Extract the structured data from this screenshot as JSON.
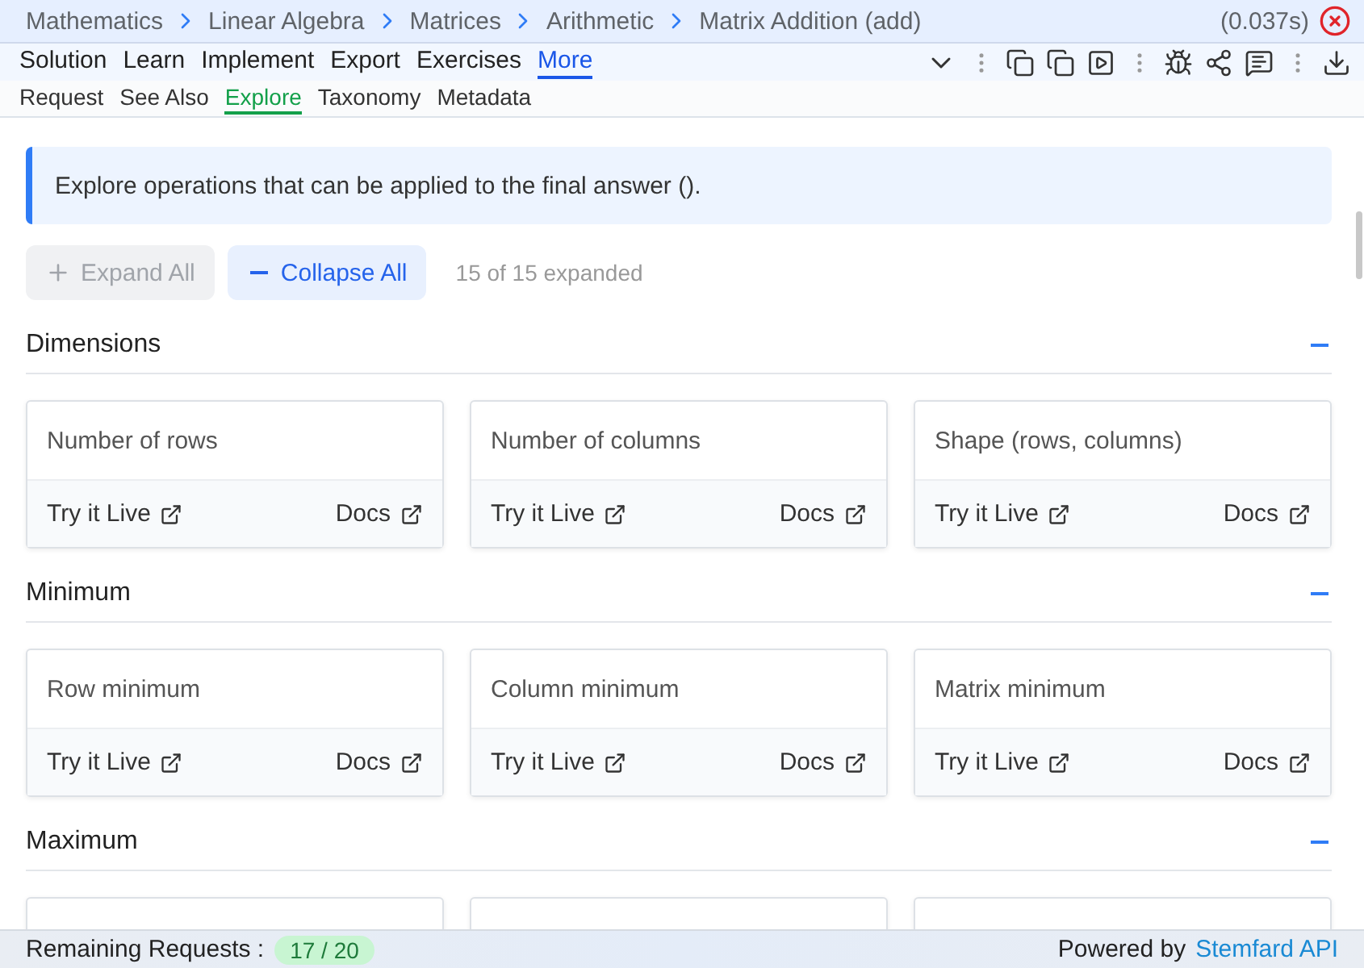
{
  "breadcrumbs": [
    "Mathematics",
    "Linear Algebra",
    "Matrices",
    "Arithmetic",
    "Matrix Addition (add)"
  ],
  "timing": "(0.037s)",
  "tabs": [
    {
      "label": "Solution",
      "selected": false
    },
    {
      "label": "Learn",
      "selected": false
    },
    {
      "label": "Implement",
      "selected": false
    },
    {
      "label": "Export",
      "selected": false
    },
    {
      "label": "Exercises",
      "selected": false
    },
    {
      "label": "More",
      "selected": true
    }
  ],
  "subtabs": [
    {
      "label": "Request",
      "selected": false
    },
    {
      "label": "See Also",
      "selected": false
    },
    {
      "label": "Explore",
      "selected": true
    },
    {
      "label": "Taxonomy",
      "selected": false
    },
    {
      "label": "Metadata",
      "selected": false
    }
  ],
  "info": "Explore operations that can be applied to the final answer ().",
  "expand_button": {
    "label": "Expand All",
    "disabled": true
  },
  "collapse_button": {
    "label": "Collapse All",
    "disabled": false
  },
  "expanded_count": "15 of 15 expanded",
  "sections": [
    {
      "title": "Dimensions",
      "expanded": true,
      "cards": [
        {
          "kind": "full",
          "title": "Number of rows",
          "try": "Try it Live",
          "docs": "Docs"
        },
        {
          "kind": "full",
          "title": "Number of columns",
          "try": "Try it Live",
          "docs": "Docs"
        },
        {
          "kind": "full",
          "title": "Shape (rows, columns)",
          "try": "Try it Live",
          "docs": "Docs"
        }
      ]
    },
    {
      "title": "Minimum",
      "expanded": true,
      "cards": [
        {
          "kind": "full",
          "title": "Row minimum",
          "try": "Try it Live",
          "docs": "Docs"
        },
        {
          "kind": "full",
          "title": "Column minimum",
          "try": "Try it Live",
          "docs": "Docs"
        },
        {
          "kind": "full",
          "title": "Matrix minimum",
          "try": "Try it Live",
          "docs": "Docs"
        }
      ]
    },
    {
      "title": "Maximum",
      "expanded": true,
      "cards": [
        {
          "kind": "clipped"
        },
        {
          "kind": "clipped"
        },
        {
          "kind": "clipped"
        }
      ]
    }
  ],
  "footer": {
    "label": "Remaining Requests :",
    "badge": "17 / 20",
    "powered": "Powered by",
    "link": "Stemfard API"
  }
}
